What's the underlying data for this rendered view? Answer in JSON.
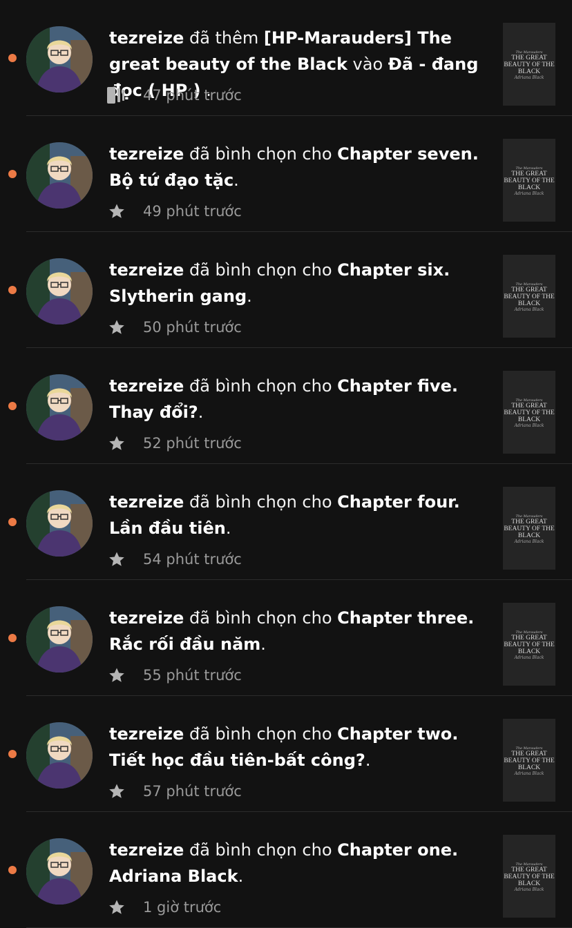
{
  "feed": {
    "items": [
      {
        "user": "tezreize",
        "verb": "đã thêm",
        "title": "[HP-Marauders] The great beauty of the Black",
        "connector": "vào",
        "target": "Đã - đang đọc ( HP )",
        "end": ".",
        "icon": "reading-list-icon",
        "time": "47 phút trước",
        "thumb": {
          "small": "The Marauders",
          "big": "THE GREAT BEAUTY OF THE BLACK",
          "sign": "Adriana Black"
        }
      },
      {
        "user": "tezreize",
        "verb": "đã bình chọn cho",
        "title": "Chapter seven. Bộ tứ đạo tặc",
        "end": ".",
        "icon": "star-icon",
        "time": "49 phút trước",
        "thumb": {
          "small": "The Marauders",
          "big": "THE GREAT BEAUTY OF THE BLACK",
          "sign": "Adriana Black"
        }
      },
      {
        "user": "tezreize",
        "verb": "đã bình chọn cho",
        "title": "Chapter six. Slytherin gang",
        "end": ".",
        "icon": "star-icon",
        "time": "50 phút trước",
        "thumb": {
          "small": "The Marauders",
          "big": "THE GREAT BEAUTY OF THE BLACK",
          "sign": "Adriana Black"
        }
      },
      {
        "user": "tezreize",
        "verb": "đã bình chọn cho",
        "title": "Chapter five. Thay đổi?",
        "end": ".",
        "icon": "star-icon",
        "time": "52 phút trước",
        "thumb": {
          "small": "The Marauders",
          "big": "THE GREAT BEAUTY OF THE BLACK",
          "sign": "Adriana Black"
        }
      },
      {
        "user": "tezreize",
        "verb": "đã bình chọn cho",
        "title": "Chapter four. Lần đầu tiên",
        "end": ".",
        "icon": "star-icon",
        "time": "54 phút trước",
        "thumb": {
          "small": "The Marauders",
          "big": "THE GREAT BEAUTY OF THE BLACK",
          "sign": "Adriana Black"
        }
      },
      {
        "user": "tezreize",
        "verb": "đã bình chọn cho",
        "title": "Chapter three. Rắc rối đầu năm",
        "end": ".",
        "icon": "star-icon",
        "time": "55 phút trước",
        "thumb": {
          "small": "The Marauders",
          "big": "THE GREAT BEAUTY OF THE BLACK",
          "sign": "Adriana Black"
        }
      },
      {
        "user": "tezreize",
        "verb": "đã bình chọn cho",
        "title": "Chapter two. Tiết học đầu tiên-bất công?",
        "end": ".",
        "icon": "star-icon",
        "time": "57 phút trước",
        "thumb": {
          "small": "The Marauders",
          "big": "THE GREAT BEAUTY OF THE BLACK",
          "sign": "Adriana Black"
        }
      },
      {
        "user": "tezreize",
        "verb": "đã bình chọn cho",
        "title": "Chapter one. Adriana Black",
        "end": ".",
        "icon": "star-icon",
        "time": "1 giờ trước",
        "thumb": {
          "small": "The Marauders",
          "big": "THE GREAT BEAUTY OF THE BLACK",
          "sign": "Adriana Black"
        }
      }
    ]
  },
  "colors": {
    "background": "#121212",
    "unread_dot": "#ec7a45",
    "meta_text": "#9a9a9a",
    "icon": "#b5b5b5"
  }
}
